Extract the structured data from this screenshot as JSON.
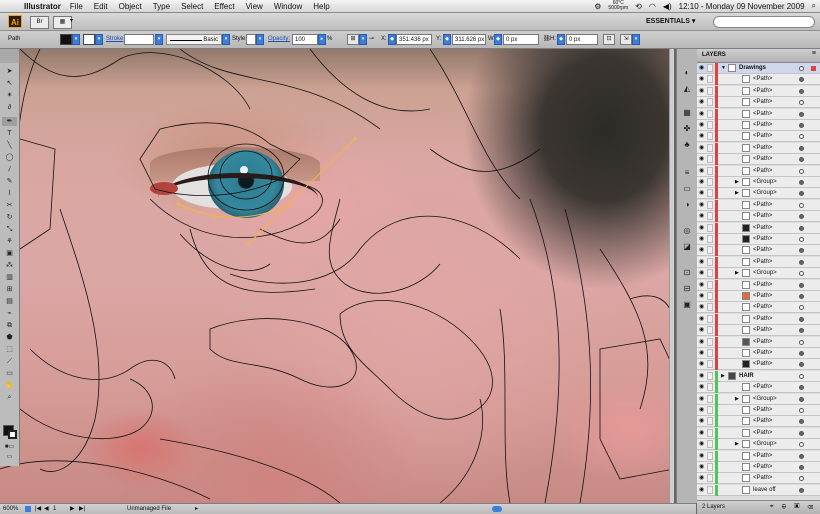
{
  "menubar": {
    "app_name": "Illustrator",
    "items": [
      "File",
      "Edit",
      "Object",
      "Type",
      "Select",
      "Effect",
      "View",
      "Window",
      "Help"
    ],
    "temp_top": "60°C",
    "temp_bottom": "5000rpm",
    "clock": "12:10 - Monday 09 November 2009"
  },
  "appbar": {
    "logo": "Ai",
    "workspace": "ESSENTIALS"
  },
  "control": {
    "selection_label": "Path",
    "stroke_label": "Stroke",
    "brush_label": "Basic",
    "style_label": "Style:",
    "opacity_label": "Opacity:",
    "opacity_value": "100",
    "opacity_unit": "%",
    "x_label": "X:",
    "x_value": "351.436 px",
    "y_label": "Y:",
    "y_value": "311.626 px",
    "w_label": "W:",
    "w_value": "0 px",
    "h_label": "H:",
    "h_value": "0 px"
  },
  "layers": {
    "title": "LAYERS",
    "count_label": "2 Layers",
    "rows": [
      {
        "name": "Drawings",
        "level": 0,
        "color": "#e34040",
        "selected": true,
        "toggle": "▼",
        "thumb": "#ffffff"
      },
      {
        "name": "<Path>",
        "level": 1,
        "color": "#e34040",
        "toggle": "",
        "thumb": "#ffffff"
      },
      {
        "name": "<Path>",
        "level": 1,
        "color": "#e34040",
        "toggle": "",
        "thumb": "#ffffff"
      },
      {
        "name": "<Path>",
        "level": 1,
        "color": "#e34040",
        "toggle": "",
        "thumb": "#ffffff"
      },
      {
        "name": "<Path>",
        "level": 1,
        "color": "#e34040",
        "toggle": "",
        "thumb": "#ffffff"
      },
      {
        "name": "<Path>",
        "level": 1,
        "color": "#e34040",
        "toggle": "",
        "thumb": "#ffffff"
      },
      {
        "name": "<Path>",
        "level": 1,
        "color": "#e34040",
        "toggle": "",
        "thumb": "#ffffff"
      },
      {
        "name": "<Path>",
        "level": 1,
        "color": "#e34040",
        "toggle": "",
        "thumb": "#ffffff"
      },
      {
        "name": "<Path>",
        "level": 1,
        "color": "#e34040",
        "toggle": "",
        "thumb": "#ffffff"
      },
      {
        "name": "<Path>",
        "level": 1,
        "color": "#e34040",
        "toggle": "",
        "thumb": "#ffffff"
      },
      {
        "name": "<Group>",
        "level": 1,
        "color": "#e34040",
        "toggle": "▶",
        "thumb": "#ffffff"
      },
      {
        "name": "<Group>",
        "level": 1,
        "color": "#e34040",
        "toggle": "▶",
        "thumb": "#ffffff"
      },
      {
        "name": "<Path>",
        "level": 1,
        "color": "#e34040",
        "toggle": "",
        "thumb": "#ffffff"
      },
      {
        "name": "<Path>",
        "level": 1,
        "color": "#e34040",
        "toggle": "",
        "thumb": "#ffffff"
      },
      {
        "name": "<Path>",
        "level": 1,
        "color": "#e34040",
        "toggle": "",
        "thumb": "#222222"
      },
      {
        "name": "<Path>",
        "level": 1,
        "color": "#e34040",
        "toggle": "",
        "thumb": "#222222"
      },
      {
        "name": "<Path>",
        "level": 1,
        "color": "#e34040",
        "toggle": "",
        "thumb": "#ffffff"
      },
      {
        "name": "<Path>",
        "level": 1,
        "color": "#e34040",
        "toggle": "",
        "thumb": "#ffffff"
      },
      {
        "name": "<Group>",
        "level": 1,
        "color": "#e34040",
        "toggle": "▶",
        "thumb": "#ffffff"
      },
      {
        "name": "<Path>",
        "level": 1,
        "color": "#e34040",
        "toggle": "",
        "thumb": "#ffffff"
      },
      {
        "name": "<Path>",
        "level": 1,
        "color": "#e34040",
        "toggle": "",
        "thumb": "#e5673c"
      },
      {
        "name": "<Path>",
        "level": 1,
        "color": "#e34040",
        "toggle": "",
        "thumb": "#ffffff"
      },
      {
        "name": "<Path>",
        "level": 1,
        "color": "#e34040",
        "toggle": "",
        "thumb": "#ffffff"
      },
      {
        "name": "<Path>",
        "level": 1,
        "color": "#e34040",
        "toggle": "",
        "thumb": "#ffffff"
      },
      {
        "name": "<Path>",
        "level": 1,
        "color": "#e34040",
        "toggle": "",
        "thumb": "#555555"
      },
      {
        "name": "<Path>",
        "level": 1,
        "color": "#e34040",
        "toggle": "",
        "thumb": "#ffffff"
      },
      {
        "name": "<Path>",
        "level": 1,
        "color": "#e34040",
        "toggle": "",
        "thumb": "#222222"
      },
      {
        "name": "HAIR",
        "level": 0,
        "color": "#4dc65a",
        "selected": false,
        "toggle": "▶",
        "thumb": "#444444"
      },
      {
        "name": "<Path>",
        "level": 1,
        "color": "#4dc65a",
        "toggle": "",
        "thumb": "#ffffff"
      },
      {
        "name": "<Group>",
        "level": 1,
        "color": "#4dc65a",
        "toggle": "▶",
        "thumb": "#ffffff"
      },
      {
        "name": "<Path>",
        "level": 1,
        "color": "#4dc65a",
        "toggle": "",
        "thumb": "#ffffff"
      },
      {
        "name": "<Path>",
        "level": 1,
        "color": "#4dc65a",
        "toggle": "",
        "thumb": "#ffffff"
      },
      {
        "name": "<Path>",
        "level": 1,
        "color": "#4dc65a",
        "toggle": "",
        "thumb": "#ffffff"
      },
      {
        "name": "<Group>",
        "level": 1,
        "color": "#4dc65a",
        "toggle": "▶",
        "thumb": "#ffffff"
      },
      {
        "name": "<Path>",
        "level": 1,
        "color": "#4dc65a",
        "toggle": "",
        "thumb": "#ffffff"
      },
      {
        "name": "<Path>",
        "level": 1,
        "color": "#4dc65a",
        "toggle": "",
        "thumb": "#ffffff"
      },
      {
        "name": "<Path>",
        "level": 1,
        "color": "#4dc65a",
        "toggle": "",
        "thumb": "#ffffff"
      },
      {
        "name": "leave off",
        "level": 1,
        "color": "#4dc65a",
        "toggle": "",
        "thumb": "#ffffff"
      }
    ]
  },
  "status": {
    "zoom": "600%",
    "page": "1",
    "file_status": "Unmanaged File"
  },
  "colors": {
    "accent_blue": "#3b7ddb",
    "drawings_layer": "#e34040",
    "hair_layer": "#4dc65a",
    "anchor_orange": "#f2b44a"
  }
}
